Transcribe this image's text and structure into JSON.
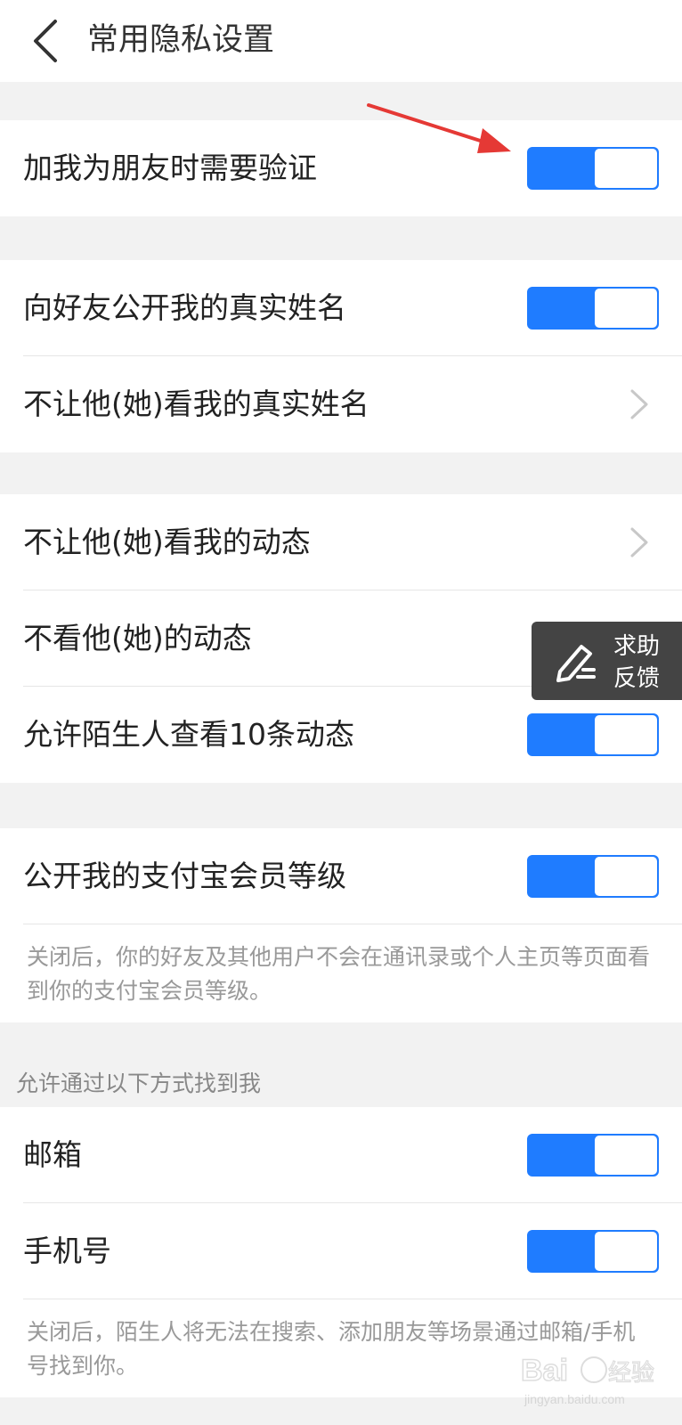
{
  "header": {
    "title": "常用隐私设置",
    "back_icon": "chevron-left-icon"
  },
  "settings": {
    "friend_verification": {
      "label": "加我为朋友时需要验证",
      "enabled": true
    },
    "show_real_name": {
      "label": "向好友公开我的真实姓名",
      "enabled": true
    },
    "hide_real_name_from": {
      "label": "不让他(她)看我的真实姓名"
    },
    "hide_moments_from": {
      "label": "不让他(她)看我的动态"
    },
    "dont_see_moments": {
      "label": "不看他(她)的动态"
    },
    "strangers_view_10": {
      "label": "允许陌生人查看10条动态",
      "enabled": true
    },
    "show_member_level": {
      "label": "公开我的支付宝会员等级",
      "enabled": true
    },
    "member_level_note": "关闭后，你的好友及其他用户不会在通讯录或个人主页等页面看到你的支付宝会员等级。",
    "find_me_section": "允许通过以下方式找到我",
    "find_by_email": {
      "label": "邮箱",
      "enabled": true
    },
    "find_by_phone": {
      "label": "手机号",
      "enabled": true
    },
    "find_me_note": "关闭后，陌生人将无法在搜索、添加朋友等场景通过邮箱/手机号找到你。"
  },
  "feedback": {
    "line1": "求助",
    "line2": "反馈",
    "icon": "pen-icon"
  },
  "colors": {
    "toggle_on": "#1f7cff",
    "annotation_arrow": "#e53935"
  }
}
